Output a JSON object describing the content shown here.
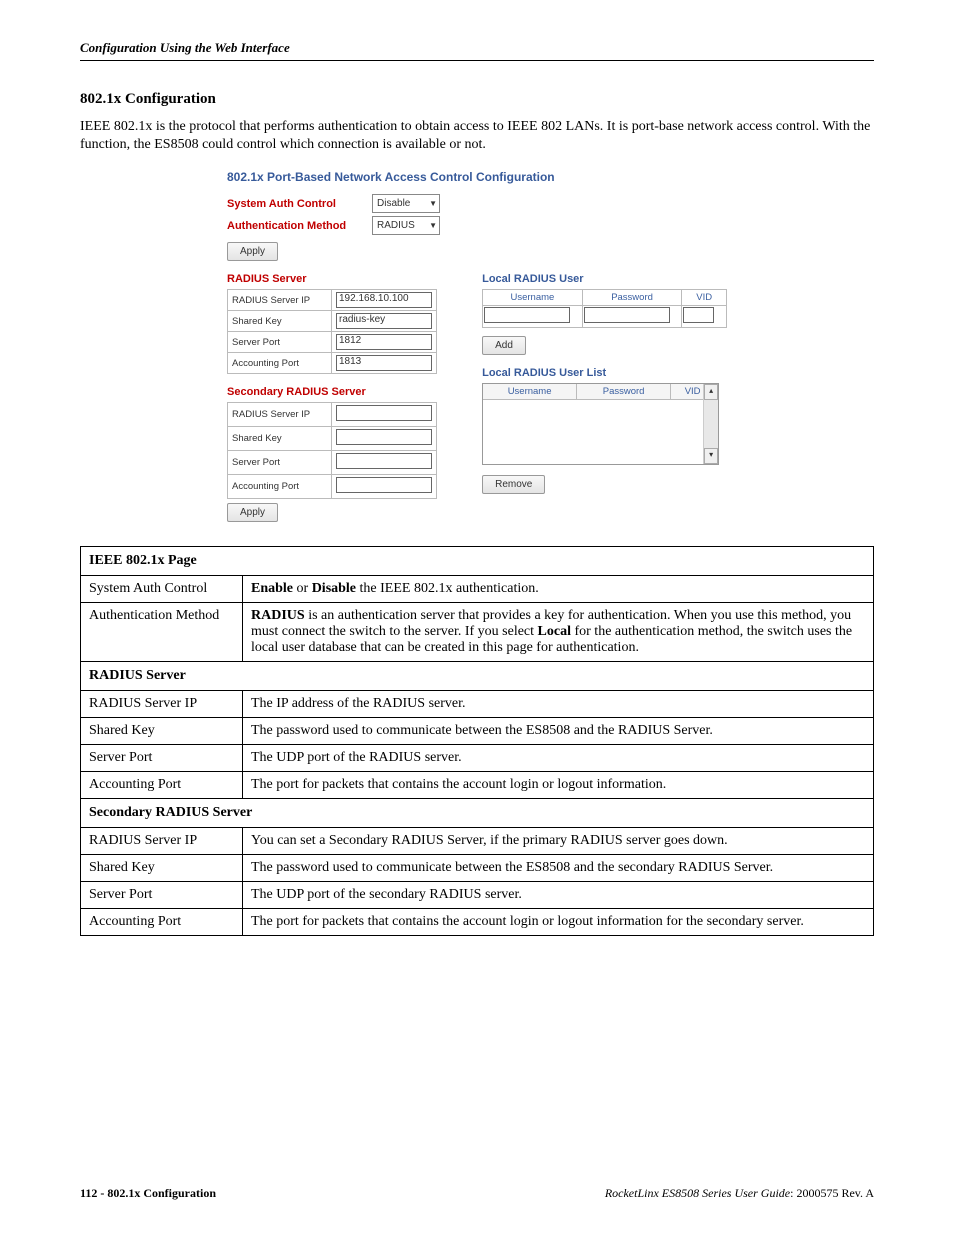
{
  "header": {
    "breadcrumb": "Configuration Using the Web Interface"
  },
  "section": {
    "heading": "802.1x Configuration",
    "intro": "IEEE 802.1x is the protocol that performs authentication to obtain access to IEEE 802 LANs. It is port-base network access control. With the function, the ES8508 could control which connection is available or not."
  },
  "screenshot": {
    "title": "802.1x Port-Based Network Access Control Configuration",
    "sysAuthLabel": "System Auth Control",
    "sysAuthValue": "Disable",
    "authMethodLabel": "Authentication Method",
    "authMethodValue": "RADIUS",
    "applyBtn": "Apply",
    "radiusServer": {
      "head": "RADIUS Server",
      "rows": [
        {
          "label": "RADIUS Server IP",
          "value": "192.168.10.100"
        },
        {
          "label": "Shared Key",
          "value": "radius-key"
        },
        {
          "label": "Server Port",
          "value": "1812"
        },
        {
          "label": "Accounting Port",
          "value": "1813"
        }
      ]
    },
    "secondaryRadius": {
      "head": "Secondary RADIUS Server",
      "rows": [
        {
          "label": "RADIUS Server IP",
          "value": ""
        },
        {
          "label": "Shared Key",
          "value": ""
        },
        {
          "label": "Server Port",
          "value": ""
        },
        {
          "label": "Accounting Port",
          "value": ""
        }
      ]
    },
    "localUser": {
      "head": "Local RADIUS User",
      "cols": [
        "Username",
        "Password",
        "VID"
      ],
      "addBtn": "Add"
    },
    "localUserList": {
      "head": "Local RADIUS User List",
      "cols": [
        "Username",
        "Password",
        "VID"
      ],
      "removeBtn": "Remove"
    }
  },
  "table": {
    "header": "IEEE 802.1x Page",
    "rows": [
      {
        "label": "System Auth Control",
        "desc_html": "<b>Enable</b> or <b>Disable</b> the IEEE 802.1x authentication."
      },
      {
        "label": "Authentication Method",
        "desc_html": "<b>RADIUS</b> is an authentication server that provides a key for authentication. When you use this method, you must connect the switch to the server. If you select <b>Local</b> for the authentication method, the switch uses the local user database that can be created in this page for authentication."
      }
    ],
    "section1": {
      "head": "RADIUS Server",
      "rows": [
        {
          "label": "RADIUS Server IP",
          "desc": "The IP address of the RADIUS server."
        },
        {
          "label": "Shared Key",
          "desc": "The password used to communicate between the ES8508 and the RADIUS Server."
        },
        {
          "label": "Server Port",
          "desc": "The UDP port of the RADIUS server."
        },
        {
          "label": "Accounting Port",
          "desc": "The port for packets that contains the account login or logout information."
        }
      ]
    },
    "section2": {
      "head": "Secondary RADIUS Server",
      "rows": [
        {
          "label": "RADIUS Server IP",
          "desc": "You can set a Secondary RADIUS Server, if the primary RADIUS server goes down."
        },
        {
          "label": "Shared Key",
          "desc": "The password used to communicate between the ES8508 and the secondary RADIUS Server."
        },
        {
          "label": "Server Port",
          "desc": "The UDP port of the secondary RADIUS server."
        },
        {
          "label": "Accounting Port",
          "desc": "The port for packets that contains the account login or logout information for the secondary server."
        }
      ]
    }
  },
  "footer": {
    "pageLabel": "112 - 802.1x Configuration",
    "guideTitle": "RocketLinx ES8508 Series  User Guide",
    "revision": ": 2000575 Rev. A"
  }
}
